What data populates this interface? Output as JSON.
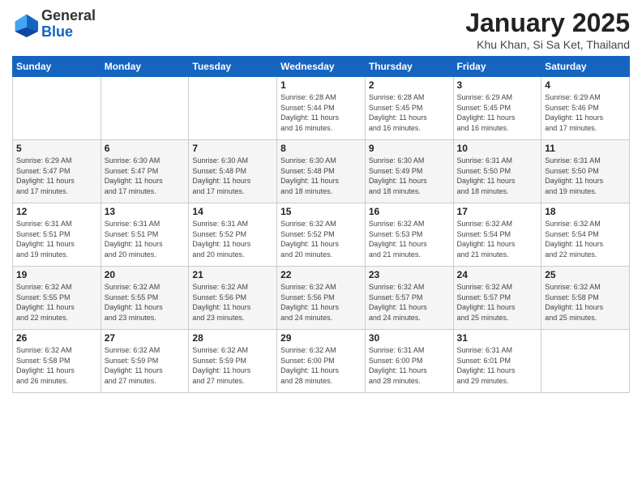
{
  "header": {
    "logo_line1": "General",
    "logo_line2": "Blue",
    "month": "January 2025",
    "location": "Khu Khan, Si Sa Ket, Thailand"
  },
  "weekdays": [
    "Sunday",
    "Monday",
    "Tuesday",
    "Wednesday",
    "Thursday",
    "Friday",
    "Saturday"
  ],
  "weeks": [
    [
      {
        "day": "",
        "info": ""
      },
      {
        "day": "",
        "info": ""
      },
      {
        "day": "",
        "info": ""
      },
      {
        "day": "1",
        "info": "Sunrise: 6:28 AM\nSunset: 5:44 PM\nDaylight: 11 hours\nand 16 minutes."
      },
      {
        "day": "2",
        "info": "Sunrise: 6:28 AM\nSunset: 5:45 PM\nDaylight: 11 hours\nand 16 minutes."
      },
      {
        "day": "3",
        "info": "Sunrise: 6:29 AM\nSunset: 5:45 PM\nDaylight: 11 hours\nand 16 minutes."
      },
      {
        "day": "4",
        "info": "Sunrise: 6:29 AM\nSunset: 5:46 PM\nDaylight: 11 hours\nand 17 minutes."
      }
    ],
    [
      {
        "day": "5",
        "info": "Sunrise: 6:29 AM\nSunset: 5:47 PM\nDaylight: 11 hours\nand 17 minutes."
      },
      {
        "day": "6",
        "info": "Sunrise: 6:30 AM\nSunset: 5:47 PM\nDaylight: 11 hours\nand 17 minutes."
      },
      {
        "day": "7",
        "info": "Sunrise: 6:30 AM\nSunset: 5:48 PM\nDaylight: 11 hours\nand 17 minutes."
      },
      {
        "day": "8",
        "info": "Sunrise: 6:30 AM\nSunset: 5:48 PM\nDaylight: 11 hours\nand 18 minutes."
      },
      {
        "day": "9",
        "info": "Sunrise: 6:30 AM\nSunset: 5:49 PM\nDaylight: 11 hours\nand 18 minutes."
      },
      {
        "day": "10",
        "info": "Sunrise: 6:31 AM\nSunset: 5:50 PM\nDaylight: 11 hours\nand 18 minutes."
      },
      {
        "day": "11",
        "info": "Sunrise: 6:31 AM\nSunset: 5:50 PM\nDaylight: 11 hours\nand 19 minutes."
      }
    ],
    [
      {
        "day": "12",
        "info": "Sunrise: 6:31 AM\nSunset: 5:51 PM\nDaylight: 11 hours\nand 19 minutes."
      },
      {
        "day": "13",
        "info": "Sunrise: 6:31 AM\nSunset: 5:51 PM\nDaylight: 11 hours\nand 20 minutes."
      },
      {
        "day": "14",
        "info": "Sunrise: 6:31 AM\nSunset: 5:52 PM\nDaylight: 11 hours\nand 20 minutes."
      },
      {
        "day": "15",
        "info": "Sunrise: 6:32 AM\nSunset: 5:52 PM\nDaylight: 11 hours\nand 20 minutes."
      },
      {
        "day": "16",
        "info": "Sunrise: 6:32 AM\nSunset: 5:53 PM\nDaylight: 11 hours\nand 21 minutes."
      },
      {
        "day": "17",
        "info": "Sunrise: 6:32 AM\nSunset: 5:54 PM\nDaylight: 11 hours\nand 21 minutes."
      },
      {
        "day": "18",
        "info": "Sunrise: 6:32 AM\nSunset: 5:54 PM\nDaylight: 11 hours\nand 22 minutes."
      }
    ],
    [
      {
        "day": "19",
        "info": "Sunrise: 6:32 AM\nSunset: 5:55 PM\nDaylight: 11 hours\nand 22 minutes."
      },
      {
        "day": "20",
        "info": "Sunrise: 6:32 AM\nSunset: 5:55 PM\nDaylight: 11 hours\nand 23 minutes."
      },
      {
        "day": "21",
        "info": "Sunrise: 6:32 AM\nSunset: 5:56 PM\nDaylight: 11 hours\nand 23 minutes."
      },
      {
        "day": "22",
        "info": "Sunrise: 6:32 AM\nSunset: 5:56 PM\nDaylight: 11 hours\nand 24 minutes."
      },
      {
        "day": "23",
        "info": "Sunrise: 6:32 AM\nSunset: 5:57 PM\nDaylight: 11 hours\nand 24 minutes."
      },
      {
        "day": "24",
        "info": "Sunrise: 6:32 AM\nSunset: 5:57 PM\nDaylight: 11 hours\nand 25 minutes."
      },
      {
        "day": "25",
        "info": "Sunrise: 6:32 AM\nSunset: 5:58 PM\nDaylight: 11 hours\nand 25 minutes."
      }
    ],
    [
      {
        "day": "26",
        "info": "Sunrise: 6:32 AM\nSunset: 5:58 PM\nDaylight: 11 hours\nand 26 minutes."
      },
      {
        "day": "27",
        "info": "Sunrise: 6:32 AM\nSunset: 5:59 PM\nDaylight: 11 hours\nand 27 minutes."
      },
      {
        "day": "28",
        "info": "Sunrise: 6:32 AM\nSunset: 5:59 PM\nDaylight: 11 hours\nand 27 minutes."
      },
      {
        "day": "29",
        "info": "Sunrise: 6:32 AM\nSunset: 6:00 PM\nDaylight: 11 hours\nand 28 minutes."
      },
      {
        "day": "30",
        "info": "Sunrise: 6:31 AM\nSunset: 6:00 PM\nDaylight: 11 hours\nand 28 minutes."
      },
      {
        "day": "31",
        "info": "Sunrise: 6:31 AM\nSunset: 6:01 PM\nDaylight: 11 hours\nand 29 minutes."
      },
      {
        "day": "",
        "info": ""
      }
    ]
  ]
}
